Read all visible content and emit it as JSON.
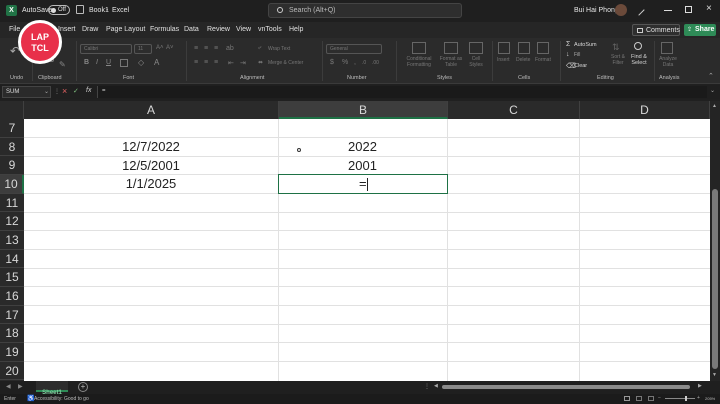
{
  "titlebar": {
    "autosave_label": "AutoSave",
    "autosave_state": "Off",
    "file_name": "Book1",
    "app_name": "Excel",
    "search_placeholder": "Search (Alt+Q)",
    "user_name": "Bui Hai Phong",
    "logo_text_1": "LAP",
    "logo_text_2": "TCL",
    "minimize_icon": "minimize-icon",
    "maximize_icon": "restore-icon",
    "close_icon": "close-icon"
  },
  "menu": {
    "items": [
      "File",
      "Insert",
      "Draw",
      "Page Layout",
      "Formulas",
      "Data",
      "Review",
      "View",
      "vnTools",
      "Help"
    ],
    "comments_label": "Comments",
    "share_label": "Share"
  },
  "ribbon": {
    "groups": [
      "Undo",
      "Clipboard",
      "Font",
      "Alignment",
      "Number",
      "Styles",
      "Cells",
      "Editing",
      "Analysis"
    ],
    "font_name": "Calibri",
    "font_size": "11",
    "wrap_text": "Wrap Text",
    "merge_center": "Merge & Center",
    "number_format": "General",
    "conditional_formatting": "Conditional Formatting",
    "format_as_table": "Format as Table",
    "cell_styles": "Cell Styles",
    "insert": "Insert",
    "delete": "Delete",
    "format": "Format",
    "autosum": "AutoSum",
    "fill": "Fill",
    "clear": "Clear",
    "sort_filter": "Sort & Filter",
    "find_select": "Find & Select",
    "analyze_data": "Analyze Data"
  },
  "formula_bar": {
    "name_box": "SUM",
    "fx_label": "fx",
    "content": "="
  },
  "columns": [
    "A",
    "B",
    "C",
    "D"
  ],
  "rows": [
    "7",
    "8",
    "9",
    "10",
    "11",
    "12",
    "13",
    "14",
    "15",
    "16",
    "17",
    "18",
    "19",
    "20"
  ],
  "cells": {
    "a8": "12/7/2022",
    "a9": "12/5/2001",
    "a10": "1/1/2025",
    "b8": "2022",
    "b9": "2001",
    "b10": "="
  },
  "sheets": {
    "tabs": [
      "Sheet1"
    ],
    "add_icon": "plus-icon"
  },
  "status": {
    "mode": "Enter",
    "accessibility": "Accessibility: Good to go",
    "zoom": "205%"
  },
  "colors": {
    "excel_green": "#217346",
    "share_green": "#2e8b57",
    "logo_red": "#e8304a",
    "selection_green": "#1e7145"
  }
}
